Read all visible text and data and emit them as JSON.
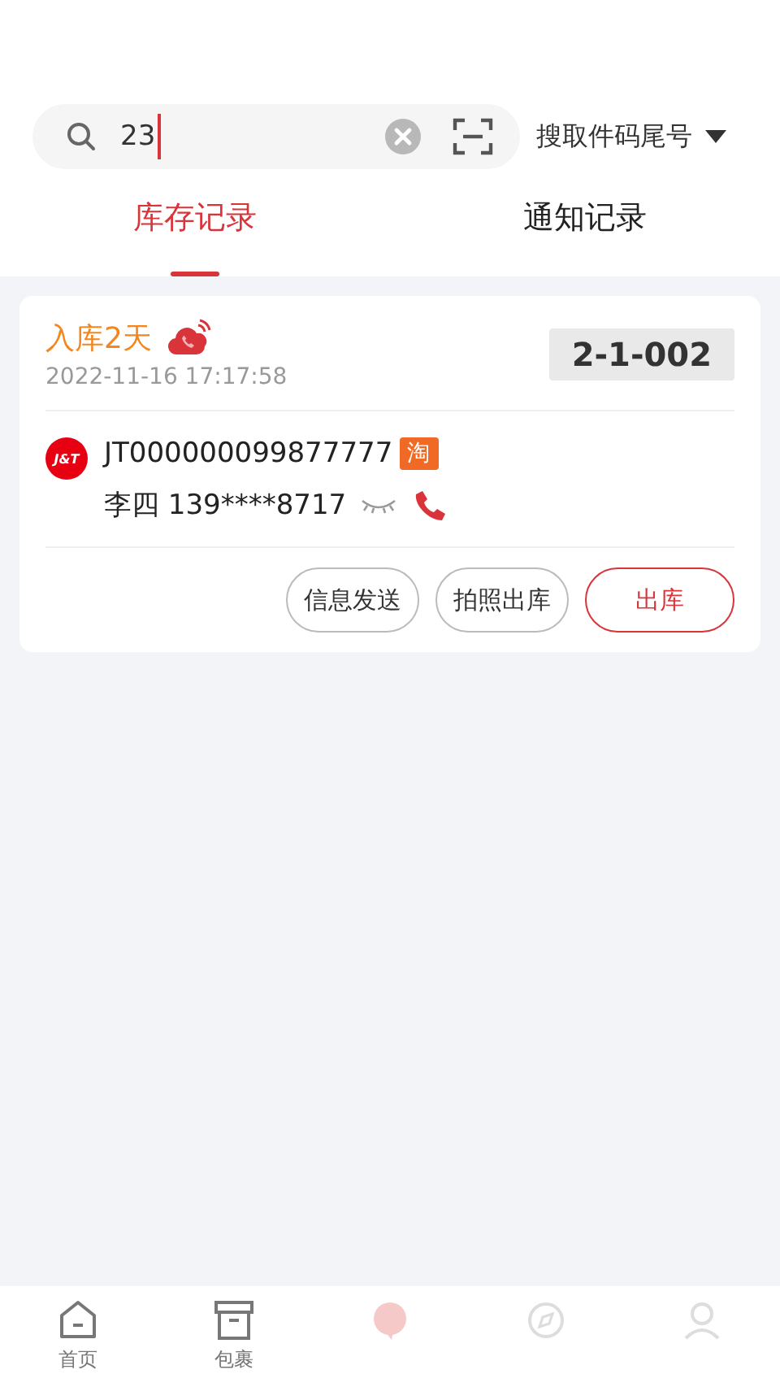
{
  "search": {
    "value": "23",
    "mode": "搜取件码尾号"
  },
  "tabs": [
    {
      "label": "库存记录",
      "selected": true
    },
    {
      "label": "通知记录",
      "selected": false
    }
  ],
  "records": [
    {
      "age": "入库2天",
      "time": "2022-11-16 17:17:58",
      "shelf_code": "2-1-002",
      "carrier": "J&T",
      "tracking": "JT000000099877777",
      "source_tag": "淘",
      "recipient": "李四 139****8717",
      "actions": [
        {
          "label": "信息发送",
          "kind": "outline"
        },
        {
          "label": "拍照出库",
          "kind": "outline"
        },
        {
          "label": "出库",
          "kind": "primary"
        }
      ]
    }
  ],
  "nav": [
    {
      "kind": "home",
      "label": "首页"
    },
    {
      "kind": "box",
      "label": "包裹"
    },
    {
      "kind": "chat"
    },
    {
      "kind": "compass"
    },
    {
      "kind": "person"
    }
  ]
}
